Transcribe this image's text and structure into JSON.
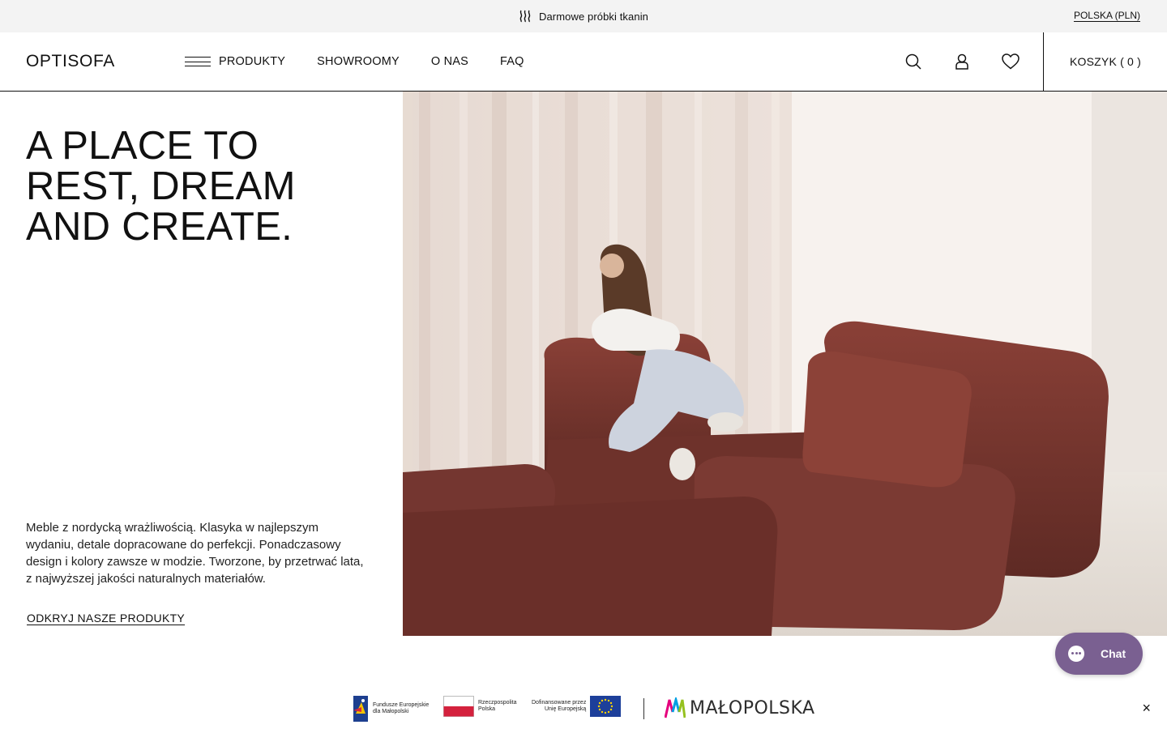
{
  "topbar": {
    "promo_text": "Darmowe próbki tkanin",
    "promo_icon": "fabric-waves-icon",
    "country_label": "POLSKA (PLN)"
  },
  "header": {
    "logo": "OPTISOFA",
    "nav": [
      {
        "label": "PRODUKTY"
      },
      {
        "label": "SHOWROOMY"
      },
      {
        "label": "O NAS"
      },
      {
        "label": "FAQ"
      }
    ],
    "icons": [
      "search-icon",
      "account-icon",
      "wishlist-heart-icon"
    ],
    "cart_label": "KOSZYK ( 0 )"
  },
  "hero": {
    "headline_lines": [
      "A PLACE TO",
      "REST, DREAM",
      "AND CREATE."
    ],
    "lead": "Meble z nordycką wrażliwością. Klasyka w najlepszym wydaniu, detale dopracowane do perfekcji. Ponadczasowy design i kolory zawsze w modzie. Tworzone, by przetrwać lata, z najwyższej jakości naturalnych materiałów.",
    "cta": "ODKRYJ NASZE PRODUKTY"
  },
  "chat": {
    "label": "Chat",
    "color": "#7a6091"
  },
  "funding": {
    "fe_line1": "Fundusze Europejskie",
    "fe_line2": "dla Małopolski",
    "rp_line1": "Rzeczpospolita",
    "rp_line2": "Polska",
    "eu_line1": "Dofinansowane przez",
    "eu_line2": "Unię Europejską",
    "region": "MAŁOPOLSKA",
    "close": "×"
  },
  "colors": {
    "sofa": "#7b3a33",
    "topbar_bg": "#f3f3f3",
    "accent": "#111111"
  }
}
